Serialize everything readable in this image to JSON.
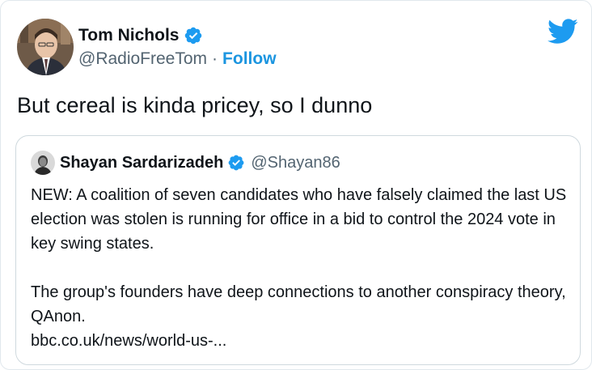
{
  "tweet": {
    "author": {
      "name": "Tom Nichols",
      "handle": "@RadioFreeTom",
      "separator": "·",
      "follow_label": "Follow",
      "verified": true
    },
    "text": "But cereal is kinda pricey, so I dunno",
    "quoted": {
      "author_name": "Shayan Sardarizadeh",
      "handle": "@Shayan86",
      "verified": true,
      "paragraph1": "NEW: A coalition of seven candidates who have falsely claimed the last US election was stolen is running for office in a bid to control the 2024 vote in key swing states.",
      "paragraph2_line1": "The group's founders have deep connections to another conspiracy theory, QAnon.",
      "link": "bbc.co.uk/news/world-us-..."
    }
  },
  "icons": {
    "logo": "twitter-bird-icon",
    "verified": "verified-badge-icon"
  },
  "colors": {
    "accent": "#1b95e0",
    "verified": "#1d9bf0",
    "secondary_text": "#536471",
    "border": "#cfd9de"
  }
}
